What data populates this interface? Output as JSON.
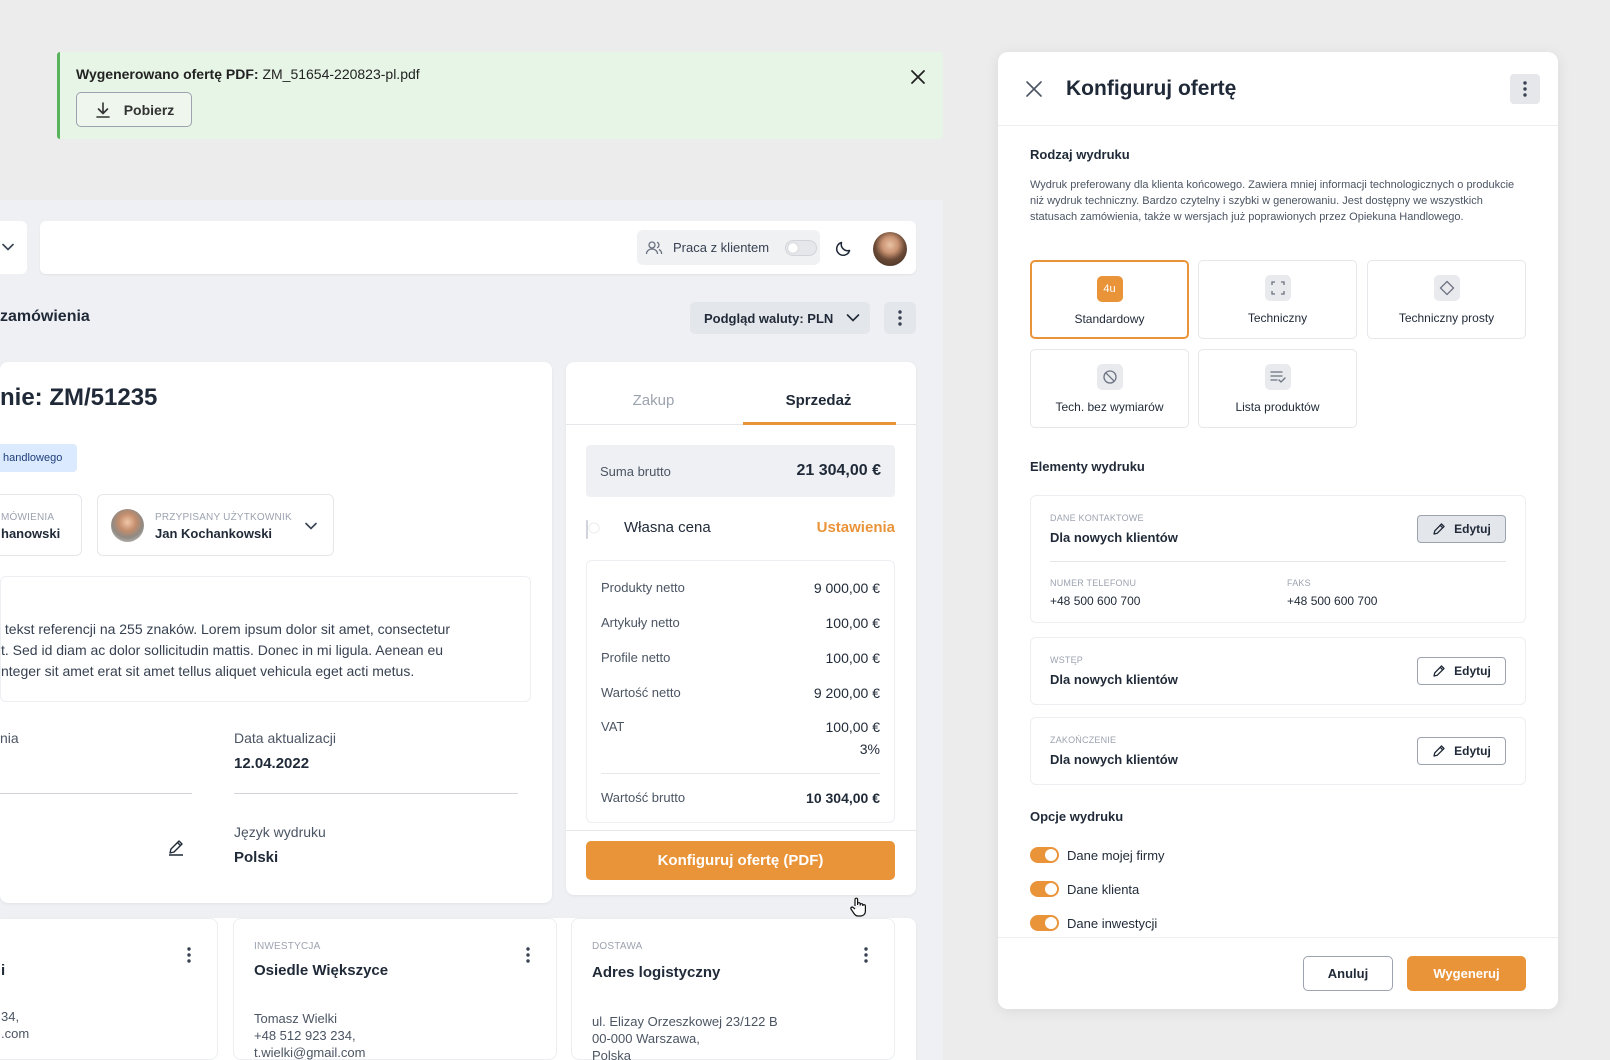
{
  "toast": {
    "title_bold": "Wygenerowano ofertę PDF:",
    "filename": "ZM_51654-220823-pl.pdf",
    "download_label": "Pobierz"
  },
  "topbar": {
    "work_with_client_label": "Praca z klientem",
    "work_with_client_on": false
  },
  "section": {
    "title": "zamówienia",
    "currency_label": "Podgląd waluty: PLN"
  },
  "order": {
    "title": "nie: ZM/51235",
    "chip": "handlowego",
    "user1_caption": "MÓWIENIA",
    "user1_name": "hanowski",
    "user2_caption": "PRZYPISANY UŻYTKOWNIK",
    "user2_name": "Jan Kochankowski",
    "reference_lines": [
      " tekst referencji na 255 znaków. Lorem ipsum dolor sit amet, consectetur",
      "t. Sed id diam ac dolor sollicitudin mattis. Donec in mi ligula. Aenean eu",
      "nteger sit amet erat sit amet tellus aliquet vehicula eget acti metus."
    ],
    "left_label": "nia",
    "update_label": "Data aktualizacji",
    "update_value": "12.04.2022",
    "lang_label": "Język wydruku",
    "lang_value": "Polski"
  },
  "pricing": {
    "tab_purchase": "Zakup",
    "tab_sale": "Sprzedaż",
    "gross_sum_label": "Suma brutto",
    "gross_sum_value": "21 304,00 €",
    "own_price_label": "Własna cena",
    "settings_link": "Ustawienia",
    "rows": [
      {
        "label": "Produkty netto",
        "value": "9 000,00 €"
      },
      {
        "label": "Artykuły netto",
        "value": "100,00 €"
      },
      {
        "label": "Profile netto",
        "value": "100,00 €"
      },
      {
        "label": "Wartość netto",
        "value": "9 200,00 €"
      }
    ],
    "vat_label": "VAT",
    "vat_value": "100,00 €",
    "vat_rate": "3%",
    "gross_label": "Wartość brutto",
    "gross_value": "10 304,00 €",
    "configure_button": "Konfiguruj ofertę (PDF)"
  },
  "bottom_cards": [
    {
      "caption": "",
      "title": "i",
      "lines": [
        "34,",
        ".com"
      ]
    },
    {
      "caption": "INWESTYCJA",
      "title": "Osiedle Większyce",
      "lines": [
        "Tomasz Wielki",
        "+48 512 923 234,",
        "t.wielki@gmail.com"
      ]
    },
    {
      "caption": "DOSTAWA",
      "title": "Adres logistyczny",
      "lines": [
        "ul. Elizay Orzeszkowej 23/122 B",
        "00-000 Warszawa,",
        "Polska"
      ]
    }
  ],
  "panel": {
    "title": "Konfiguruj ofertę",
    "print_type_title": "Rodzaj wydruku",
    "print_type_desc": "Wydruk preferowany dla klienta końcowego. Zawiera mniej informacji technologicznych o produkcie niż wydruk techniczny. Bardzo czytelny i szybki w generowaniu. Jest dostępny we wszystkich statusach zamówienia, także w wersjach już poprawionych przez Opiekuna Handlowego.",
    "types": [
      {
        "label": "Standardowy",
        "icon": "4u-icon",
        "badge": "4u",
        "selected": true
      },
      {
        "label": "Techniczny",
        "icon": "scan-frame-icon",
        "selected": false
      },
      {
        "label": "Techniczny prosty",
        "icon": "diamond-icon",
        "selected": false
      },
      {
        "label": "Tech. bez wymiarów",
        "icon": "no-sign-icon",
        "selected": false
      },
      {
        "label": "Lista produktów",
        "icon": "list-check-icon",
        "selected": false
      }
    ],
    "elements_title": "Elementy wydruku",
    "contact_caption": "DANE KONTAKTOWE",
    "contact_value": "Dla nowych klientów",
    "phone_caption": "NUMER TELEFONU",
    "phone_value": "+48 500 600 700",
    "fax_caption": "FAKS",
    "fax_value": "+48 500 600 700",
    "intro_caption": "WSTĘP",
    "intro_value": "Dla nowych klientów",
    "ending_caption": "ZAKOŃCZENIE",
    "ending_value": "Dla nowych klientów",
    "edit_label": "Edytuj",
    "options_title": "Opcje wydruku",
    "options": [
      {
        "label": "Dane mojej firmy",
        "on": true
      },
      {
        "label": "Dane klienta",
        "on": true
      },
      {
        "label": "Dane inwestycji",
        "on": true
      }
    ],
    "cancel_label": "Anuluj",
    "generate_label": "Wygeneruj"
  },
  "colors": {
    "accent": "#ea943a",
    "success_bg": "#e7f5e6",
    "success_border": "#59b35a"
  }
}
